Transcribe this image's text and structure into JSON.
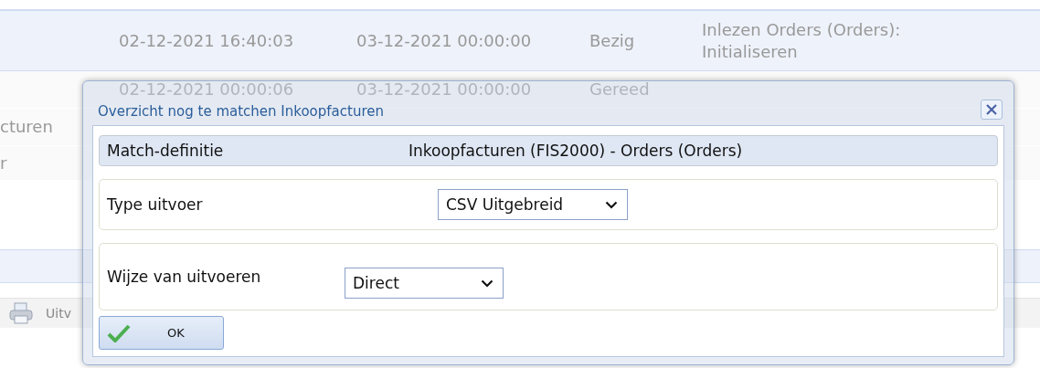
{
  "table": {
    "rows": [
      {
        "selected": true,
        "cells": [
          "02-12-2021 16:40:03",
          "03-12-2021 00:00:00",
          "Bezig",
          "Inlezen Orders (Orders): Initialiseren"
        ]
      },
      {
        "selected": false,
        "cells": [
          "02-12-2021 00:00:06",
          "03-12-2021 00:00:00",
          "Gereed"
        ]
      },
      {
        "selected": false,
        "column_1": "cturen"
      },
      {
        "selected": false,
        "column_1": "r"
      },
      {
        "selected": false
      },
      {
        "selected": false
      },
      {
        "selected": true
      }
    ]
  },
  "toolbar": {
    "print_label": "Uitv"
  },
  "dialog": {
    "title": "Overzicht nog te matchen Inkoopfacturen",
    "fields": [
      {
        "kind": "info",
        "label": "Match-definitie",
        "value": "Inkoopfacturen (FIS2000) - Orders (Orders)"
      },
      {
        "kind": "select",
        "label": "Type uitvoer",
        "value": "CSV Uitgebreid"
      },
      {
        "kind": "select",
        "label": "Wijze van uitvoeren",
        "value": "Direct"
      }
    ],
    "buttons": [
      {
        "label": "OK"
      }
    ]
  }
}
